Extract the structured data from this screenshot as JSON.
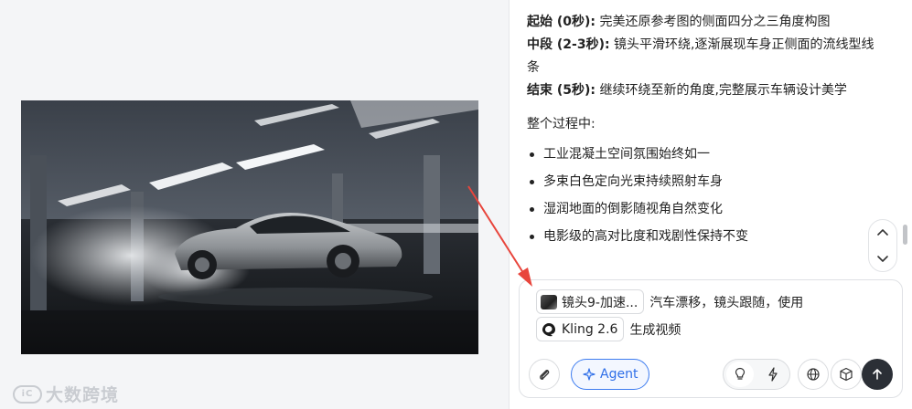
{
  "image": {
    "alt_subject": "gray sports sedan drifting in concrete parking garage with smoke"
  },
  "watermark": {
    "logo_text": "iC",
    "text": "大数跨境"
  },
  "chat": {
    "segments": [
      {
        "label": "起始 (0秒):",
        "text": " 完美还原参考图的侧面四分之三角度构图"
      },
      {
        "label": "中段 (2-3秒):",
        "text": " 镜头平滑环绕,逐渐展现车身正侧面的流线型线条"
      },
      {
        "label": "结束 (5秒):",
        "text": " 继续环绕至新的角度,完整展示车辆设计美学"
      }
    ],
    "summary_heading": "整个过程中:",
    "bullets": [
      "工业混凝土空间氛围始终如一",
      "多束白色定向光束持续照射车身",
      "湿润地面的倒影随视角自然变化",
      "电影级的高对比度和戏剧性保持不变"
    ]
  },
  "input": {
    "image_chip_label": "镜头9-加速...",
    "line1_text": "汽车漂移，镜头跟随，使用",
    "model_chip_label": "Kling 2.6",
    "line2_text": "生成视频"
  },
  "toolbar": {
    "agent_label": "Agent",
    "icons": {
      "attach": "paperclip-icon",
      "agent": "sparkle-icon",
      "idea": "lightbulb-icon",
      "fast": "lightning-icon",
      "web": "globe-icon",
      "model3d": "cube-icon",
      "send": "arrow-up-icon"
    }
  },
  "colors": {
    "accent": "#2f6fe8",
    "annotation": "#e8453c",
    "send_bg": "#2b2f36"
  }
}
